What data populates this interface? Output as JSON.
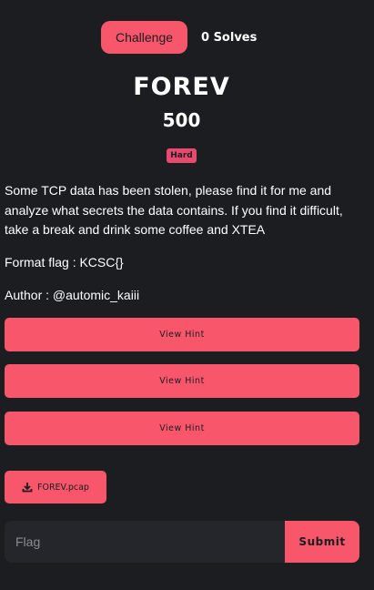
{
  "tabs": {
    "challenge_label": "Challenge",
    "solves_label": "0 Solves"
  },
  "challenge": {
    "name": "FOREV",
    "points": "500",
    "difficulty": "Hard",
    "description": "Some TCP data has been stolen, please find it for me and analyze what secrets the data contains. If you find it difficult, take a break and drink some coffee and XTEA",
    "format_flag": "Format flag : KCSC{}",
    "author": "Author : @automic_kaiii"
  },
  "hints": [
    {
      "label": "View Hint"
    },
    {
      "label": "View Hint"
    },
    {
      "label": "View Hint"
    }
  ],
  "file": {
    "name": "FOREV.pcap",
    "icon": "download-icon"
  },
  "flag_form": {
    "placeholder": "Flag",
    "value": "",
    "submit_label": "Submit"
  },
  "colors": {
    "accent": "#f8566a",
    "background": "#1c1d21",
    "badge": "#e8496e",
    "input_bg": "#25262b"
  }
}
